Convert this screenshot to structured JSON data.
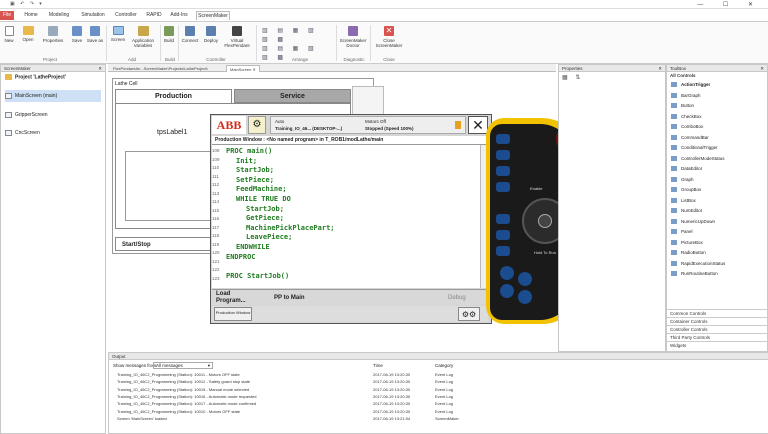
{
  "titlebar": {
    "qat": "▣ ↶ ↷ ▾",
    "controls": "— ☐ ✕"
  },
  "tabs": [
    "File",
    "Home",
    "Modeling",
    "Simulation",
    "Controller",
    "RAPID",
    "Add-Ins",
    "ScreenMaker"
  ],
  "ribbon": {
    "buttons": [
      "New",
      "Open",
      "Properties",
      "Save",
      "Save as",
      "Screen",
      "Application Variables",
      "Build",
      "Connect",
      "Deploy",
      "Virtual FlexPendant",
      "ScreenMaker Doctor",
      "Close ScreenMaker"
    ],
    "groups": [
      "Project",
      "Add",
      "Build",
      "Controller",
      "Arrange",
      "Diagnostic",
      "Close"
    ]
  },
  "screenmaker_panel": {
    "title": "ScreenMaker",
    "project": "Project 'LatheProject'",
    "items": [
      "MainScreen (main)",
      "GripperScreen",
      "CncScreen"
    ]
  },
  "doc_tabs": [
    "FlexPendantAn...ScreenMaker\\Projects\\LatheProject\\",
    "MainScreen"
  ],
  "designer": {
    "cell_title": "Lathe Cell",
    "tab_production": "Production",
    "tab_service": "Service",
    "label": "tpsLabel1",
    "start_stop": "Start/Stop"
  },
  "flexpendant": {
    "logo": "ABB",
    "status": {
      "mode": "Auto",
      "system": "Training_IO_46... (DESKTOP-...)",
      "motors": "Motors Off",
      "state": "Stopped (Speed 100%)"
    },
    "window_title": "Production Window :  <No named program> in T_ROB1/modLathe/main",
    "line_numbers": [
      "108",
      "109",
      "110",
      "111",
      "112",
      "113",
      "114",
      "115",
      "116",
      "117",
      "118",
      "119",
      "120",
      "121",
      "122",
      "123"
    ],
    "code_lines": [
      "PROC main()",
      "Init;",
      "StartJob;",
      "SetPiece;",
      "FeedMachine;",
      "WHILE TRUE DO",
      "StartJob;",
      "GetPiece;",
      "MachinePickPlacePart;",
      "LeavePiece;",
      "ENDWHILE",
      "ENDPROC",
      "",
      "PROC StartJob()"
    ],
    "code_indent": [
      0,
      1,
      1,
      1,
      1,
      1,
      2,
      2,
      2,
      2,
      1,
      0,
      0,
      0
    ],
    "btn_load": "Load Program...",
    "btn_pp": "PP to Main",
    "btn_debug": "Debug",
    "taskbar": "Production Window",
    "enable_label": "Enable",
    "hold_label": "Hold To Run"
  },
  "properties": {
    "title": "Properties"
  },
  "toolbox": {
    "title": "ToolBox",
    "category": "All Controls",
    "items": [
      "ActionTrigger",
      "BarGraph",
      "Button",
      "CheckBox",
      "ComboBox",
      "CommandBar",
      "ConditionalTrigger",
      "ControllerModeStatus",
      "DataEditor",
      "Graph",
      "GroupBox",
      "ListBox",
      "NumEditor",
      "NumericUpDown",
      "Panel",
      "PictureBox",
      "RadioButton",
      "RapidExecutionStatus",
      "RunRoutineButton"
    ],
    "categories": [
      "Common Controls",
      "Container Controls",
      "Controller Controls",
      "Third Party Controls",
      "Widgets"
    ]
  },
  "output": {
    "title": "Output",
    "filter_label": "Show messages from:",
    "filter_value": "All messages",
    "columns": [
      "Time",
      "Category"
    ],
    "rows": [
      {
        "msg": "Training_IO_46C2_Programming (Station): 10011 - Motors OFF state",
        "time": "2017-06-19 13:20:30",
        "cat": "Event Log"
      },
      {
        "msg": "Training_IO_46C2_Programming (Station): 10012 - Safety guard stop state",
        "time": "2017-06-19 13:20:30",
        "cat": "Event Log"
      },
      {
        "msg": "Training_IO_46C2_Programming (Station): 10015 - Manual mode selected",
        "time": "2017-06-19 13:20:30",
        "cat": "Event Log"
      },
      {
        "msg": "Training_IO_46C2_Programming (Station): 10016 - Automatic mode requested",
        "time": "2017-06-19 13:20:30",
        "cat": "Event Log"
      },
      {
        "msg": "Training_IO_46C2_Programming (Station): 10017 - Automatic mode confirmed",
        "time": "2017-06-19 13:20:30",
        "cat": "Event Log"
      },
      {
        "msg": "Training_IO_46C2_Programming (Station): 10010 - Motors OFF state",
        "time": "2017-06-19 13:20:30",
        "cat": "Event Log"
      },
      {
        "msg": "Screen 'MainScreen' loaded",
        "time": "2017-06-19 13:21:04",
        "cat": "ScreenMaker"
      }
    ]
  },
  "colors": {
    "accent": "#d9534f",
    "code_green": "#1e7b1e",
    "pendant_yellow": "#f2c200",
    "pendant_blue": "#1a4c8f"
  }
}
